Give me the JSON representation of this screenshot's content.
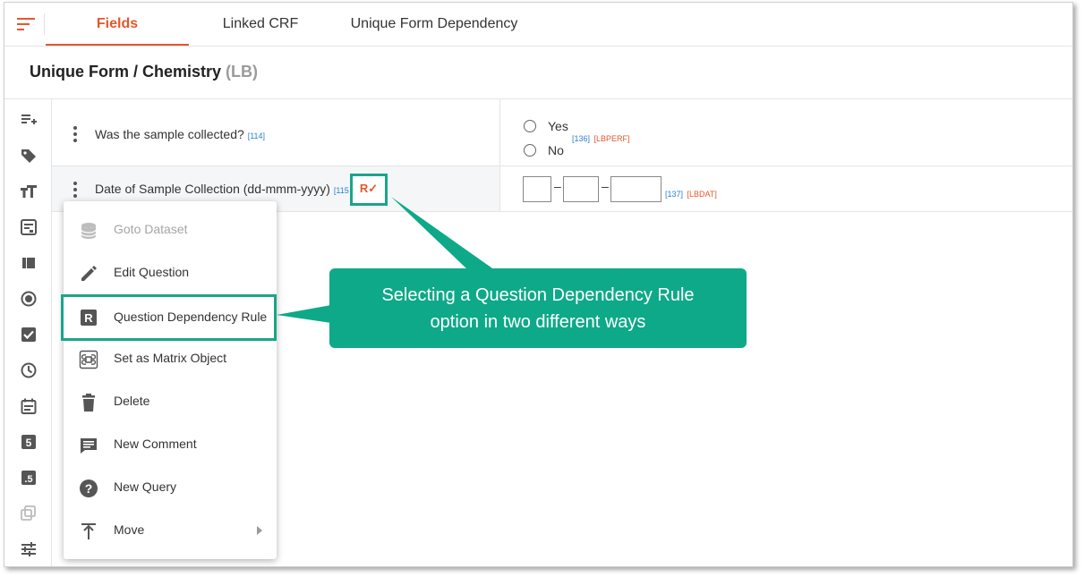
{
  "tabs": [
    {
      "label": "Fields",
      "active": true
    },
    {
      "label": "Linked CRF",
      "active": false
    },
    {
      "label": "Unique Form Dependency",
      "active": false
    }
  ],
  "form": {
    "title": "Unique Form / Chemistry",
    "code": "(LB)"
  },
  "sidebar_icons": [
    "add-field-icon",
    "tag-icon",
    "text-format-icon",
    "form-icon",
    "columns-icon",
    "radio-icon",
    "checkbox-icon",
    "clock-icon",
    "calendar-icon",
    "integer-icon",
    "decimal-icon",
    "copy-icon",
    "sliders-icon"
  ],
  "questions": [
    {
      "text": "Was the sample collected?",
      "ref": "[114]",
      "options": [
        {
          "label": "Yes"
        },
        {
          "label": "No"
        }
      ],
      "option_ref": "[136]",
      "option_var": "[LBPERF]"
    },
    {
      "text": "Date of Sample Collection (dd-mmm-yyyy)",
      "ref": "[115",
      "date_sep1": "–",
      "date_sep2": "–",
      "field_ref": "[137]",
      "field_var": "[LBDAT]",
      "rule_badge": "R✓"
    }
  ],
  "context_menu": [
    {
      "label": "Goto Dataset",
      "icon": "database-icon",
      "disabled": true
    },
    {
      "label": "Edit Question",
      "icon": "pencil-icon"
    },
    {
      "label": "Question Dependency Rule",
      "icon": "rule-icon",
      "highlighted": true
    },
    {
      "label": "Set as Matrix Object",
      "icon": "command-icon"
    },
    {
      "label": "Delete",
      "icon": "trash-icon"
    },
    {
      "label": "New Comment",
      "icon": "comment-icon"
    },
    {
      "label": "New Query",
      "icon": "help-icon"
    },
    {
      "label": "Move",
      "icon": "move-up-icon",
      "submenu": true
    }
  ],
  "callout": {
    "line1": "Selecting a Question Dependency Rule",
    "line2": "option in two different ways"
  },
  "colors": {
    "accent": "#e5572c",
    "callout": "#0ea988",
    "highlight": "#1aa58a",
    "ref": "#2a7fd4"
  }
}
